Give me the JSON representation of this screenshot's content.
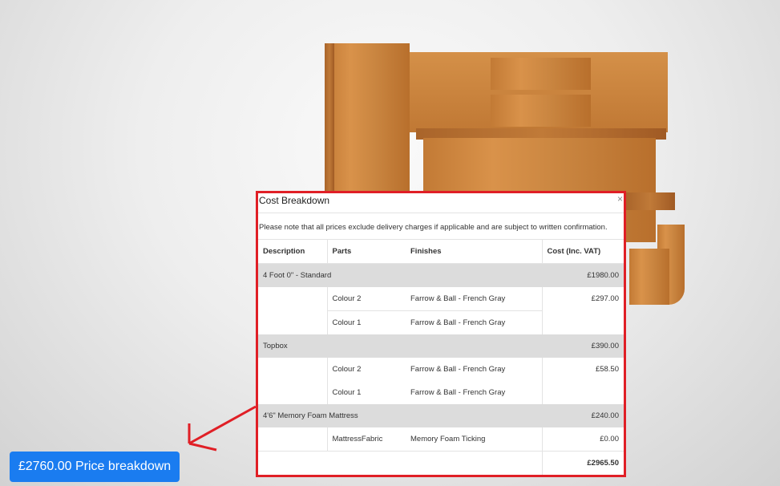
{
  "price_button": {
    "label": "£2760.00 Price breakdown"
  },
  "modal": {
    "title": "Cost Breakdown",
    "close": "×",
    "note": "Please note that all prices exclude delivery charges if applicable and are subject to written confirmation.",
    "columns": [
      "Description",
      "Parts",
      "Finishes",
      "Cost (Inc. VAT)"
    ],
    "items": [
      {
        "description": "4 Foot 0\" - Standard",
        "cost": "£1980.00",
        "parts": [
          {
            "part": "Colour 2",
            "finish": "Farrow & Ball - French Gray"
          },
          {
            "part": "Colour 1",
            "finish": "Farrow & Ball - French Gray"
          }
        ],
        "parts_cost": "£297.00"
      },
      {
        "description": "Topbox",
        "cost": "£390.00",
        "parts": [
          {
            "part": "Colour 2",
            "finish": "Farrow & Ball - French Gray"
          },
          {
            "part": "Colour 1",
            "finish": "Farrow & Ball - French Gray"
          }
        ],
        "parts_cost": "£58.50"
      },
      {
        "description": "4'6\" Memory Foam Mattress",
        "cost": "£240.00",
        "parts": [
          {
            "part": "MattressFabric",
            "finish": "Memory Foam Ticking"
          }
        ],
        "parts_cost": "£0.00"
      }
    ],
    "total": "£2965.50"
  },
  "colors": {
    "button_blue": "#1a7cf0",
    "highlight_red": "#e01f26",
    "row_grey": "#dcdcdc"
  }
}
